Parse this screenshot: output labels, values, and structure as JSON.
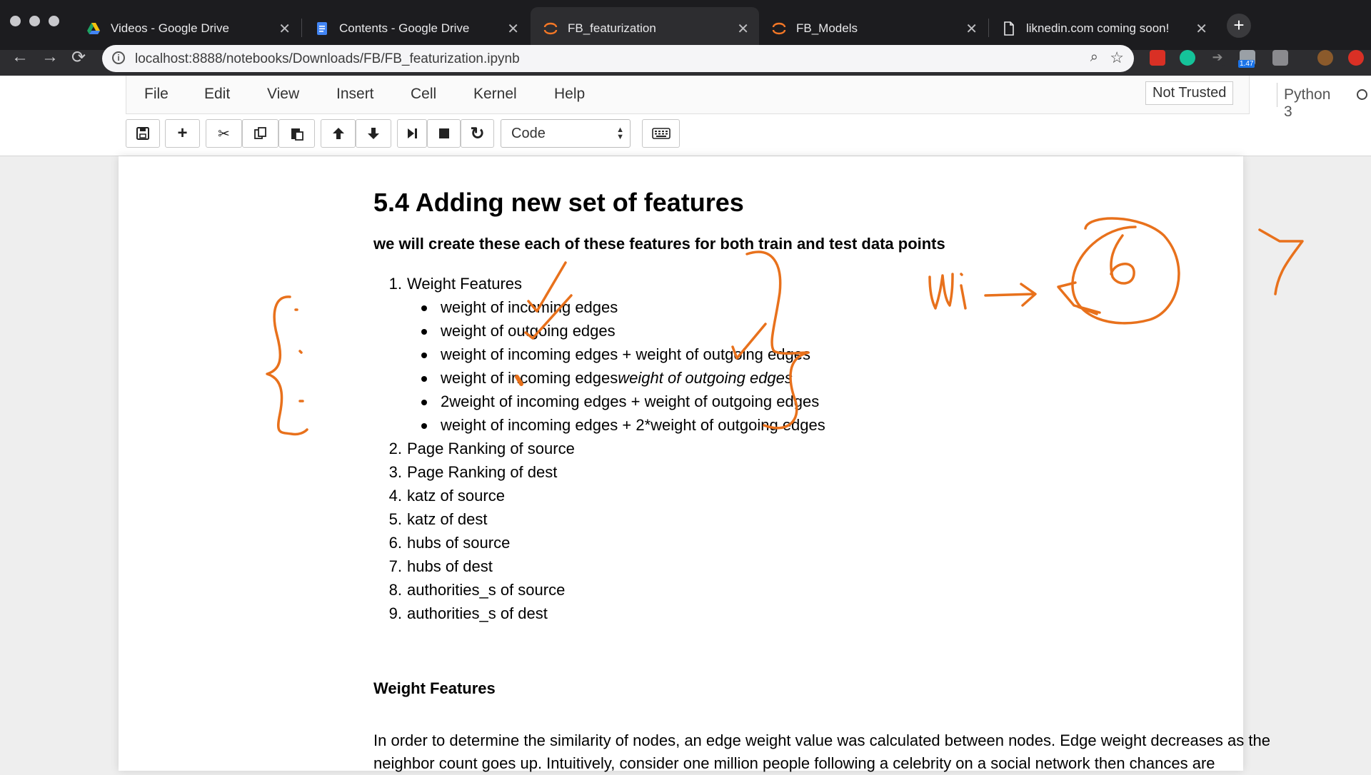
{
  "browser": {
    "tabs": [
      {
        "title": "Videos - Google Drive",
        "icon": "google-drive-icon"
      },
      {
        "title": "Contents - Google Drive",
        "icon": "google-docs-icon"
      },
      {
        "title": "FB_featurization",
        "icon": "jupyter-icon"
      },
      {
        "title": "FB_Models",
        "icon": "jupyter-icon"
      },
      {
        "title": "liknedin.com coming soon!",
        "icon": "page-icon"
      }
    ],
    "active_tab_index": 2,
    "url": "localhost:8888/notebooks/Downloads/FB/FB_featurization.ipynb",
    "extension_badge": "1.47"
  },
  "jupyter": {
    "menu": [
      "File",
      "Edit",
      "View",
      "Insert",
      "Cell",
      "Kernel",
      "Help"
    ],
    "trust_status": "Not Trusted",
    "kernel_name": "Python 3",
    "cell_type": "Code",
    "toolbar_icons": [
      "save-icon",
      "add-cell-icon",
      "cut-icon",
      "copy-icon",
      "paste-icon",
      "move-up-icon",
      "move-down-icon",
      "run-icon",
      "stop-icon",
      "restart-icon",
      "command-palette-icon"
    ]
  },
  "notebook": {
    "heading": "5.4 Adding new set of features",
    "intro": "we will create these each of these features for both train and test data points",
    "features": [
      {
        "num": "1.",
        "label": "Weight Features"
      },
      {
        "num": "2.",
        "label": "Page Ranking of source"
      },
      {
        "num": "3.",
        "label": "Page Ranking of dest"
      },
      {
        "num": "4.",
        "label": "katz of source"
      },
      {
        "num": "5.",
        "label": "katz of dest"
      },
      {
        "num": "6.",
        "label": "hubs of source"
      },
      {
        "num": "7.",
        "label": "hubs of dest"
      },
      {
        "num": "8.",
        "label": "authorities_s of source"
      },
      {
        "num": "9.",
        "label": "authorities_s of dest"
      }
    ],
    "weight_subitems": [
      "weight of incoming edges",
      "weight of outgoing edges",
      "weight of incoming edges + weight of outgoing edges",
      {
        "normal": "weight of incoming edges",
        "italic": "weight of outgoing edges"
      },
      "2weight of incoming edges + weight of outgoing edges",
      "weight of incoming edges + 2*weight of outgoing edges"
    ],
    "section_heading": "Weight Features",
    "paragraph": "In order to determine the similarity of nodes, an edge weight value was calculated between nodes. Edge weight decreases as the neighbor count goes up. Intuitively, consider one million people following a celebrity on a social network then chances are"
  },
  "annotation_color": "#e8711c"
}
